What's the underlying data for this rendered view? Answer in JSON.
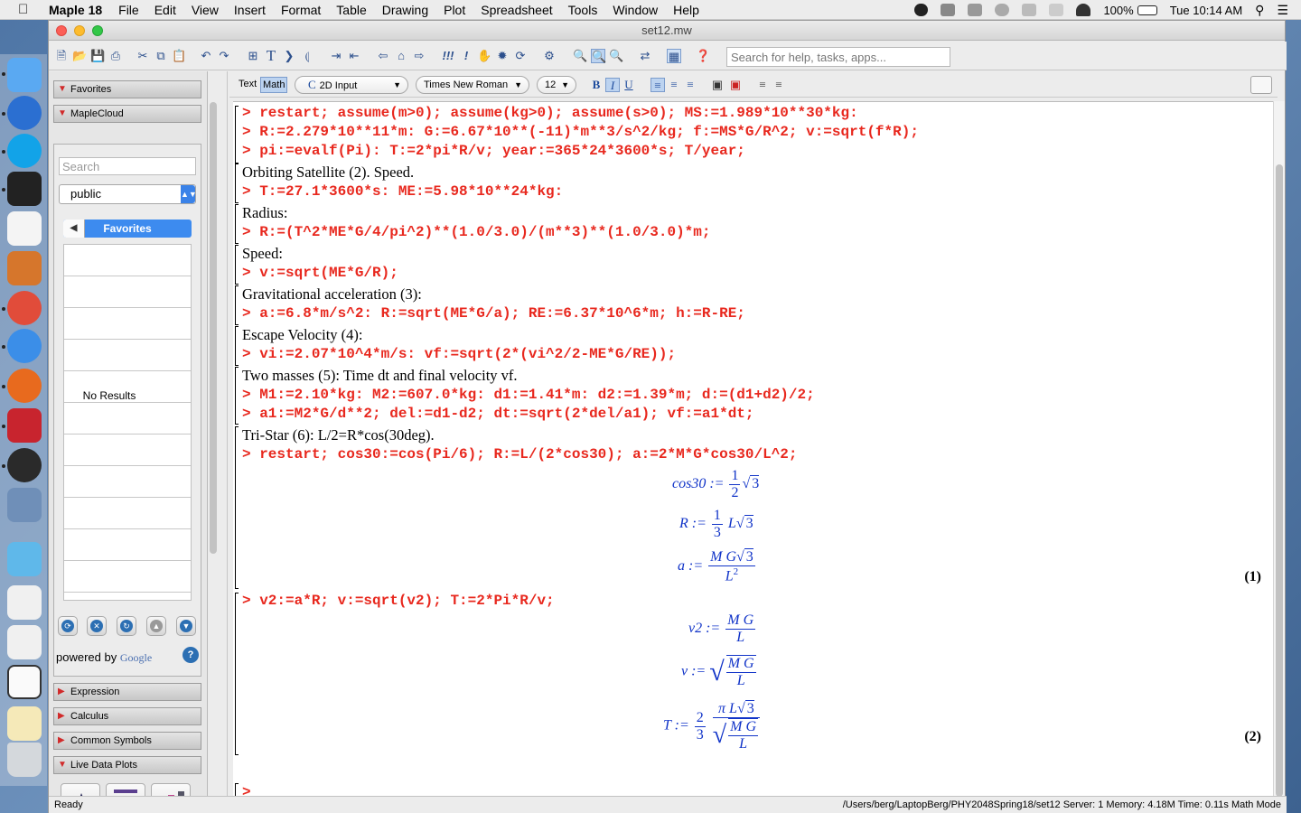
{
  "menubar": {
    "app_name": "Maple 18",
    "items": [
      "File",
      "Edit",
      "View",
      "Insert",
      "Format",
      "Table",
      "Drawing",
      "Plot",
      "Spreadsheet",
      "Tools",
      "Window",
      "Help"
    ],
    "battery": "100%",
    "clock": "Tue 10:14 AM"
  },
  "window": {
    "title": "set12.mw"
  },
  "toolbar": {
    "help_search_placeholder": "Search for help, tasks, apps..."
  },
  "palettes": {
    "favorites": "Favorites",
    "maplecloud": "MapleCloud",
    "cloud_search_placeholder": "Search",
    "cloud_group": "public",
    "cloud_tab": "Favorites",
    "no_results": "No Results",
    "powered_by": "powered by",
    "powered_brand": "Google",
    "expression": "Expression",
    "calculus": "Calculus",
    "common_symbols": "Common Symbols",
    "live_data_plots": "Live Data Plots"
  },
  "formatbar": {
    "mode_text": "Text",
    "mode_math": "Math",
    "input_style": "2D Input",
    "font": "Times New Roman",
    "size": "12"
  },
  "document": {
    "lines": [
      {
        "kind": "cmd",
        "text": "> restart; assume(m>0); assume(kg>0); assume(s>0); MS:=1.989*10**30*kg:"
      },
      {
        "kind": "cmd",
        "text": "> R:=2.279*10**11*m: G:=6.67*10**(-11)*m**3/s^2/kg; f:=MS*G/R^2; v:=sqrt(f*R);"
      },
      {
        "kind": "cmd",
        "text": "> pi:=evalf(Pi): T:=2*pi*R/v; year:=365*24*3600*s; T/year;"
      },
      {
        "kind": "txt",
        "text": "Orbiting Satellite (2). Speed."
      },
      {
        "kind": "cmd",
        "text": "> T:=27.1*3600*s: ME:=5.98*10**24*kg:"
      },
      {
        "kind": "txt",
        "text": "Radius:"
      },
      {
        "kind": "cmd",
        "text": "> R:=(T^2*ME*G/4/pi^2)**(1.0/3.0)/(m**3)**(1.0/3.0)*m;"
      },
      {
        "kind": "txt",
        "text": "Speed:"
      },
      {
        "kind": "cmd",
        "text": "> v:=sqrt(ME*G/R);"
      },
      {
        "kind": "txt",
        "text": "Gravitational acceleration (3):"
      },
      {
        "kind": "cmd",
        "text": "> a:=6.8*m/s^2: R:=sqrt(ME*G/a); RE:=6.37*10^6*m; h:=R-RE;"
      },
      {
        "kind": "txt",
        "text": "Escape Velocity (4):"
      },
      {
        "kind": "cmd",
        "text": "> vi:=2.07*10^4*m/s: vf:=sqrt(2*(vi^2/2-ME*G/RE));"
      },
      {
        "kind": "txt",
        "text": "Two masses (5): Time dt and final velocity vf."
      },
      {
        "kind": "cmd",
        "text": "> M1:=2.10*kg: M2:=607.0*kg: d1:=1.41*m: d2:=1.39*m; d:=(d1+d2)/2;"
      },
      {
        "kind": "cmd",
        "text": "> a1:=M2*G/d**2; del:=d1-d2; dt:=sqrt(2*del/a1); vf:=a1*dt;"
      },
      {
        "kind": "txt",
        "text": "Tri-Star (6): L/2=R*cos(30deg)."
      },
      {
        "kind": "cmd",
        "text": "> restart; cos30:=cos(Pi/6); R:=L/(2*cos30); a:=2*M*G*cos30/L^2;"
      }
    ],
    "out1": {
      "cos30_lhs": "cos30 :=",
      "cos30_num": "1",
      "cos30_den": "2",
      "cos30_rad": "3",
      "R_lhs": "R :=",
      "R_num": "1",
      "R_den": "3",
      "R_mid": "L",
      "R_rad": "3",
      "a_lhs": "a :=",
      "a_num": "M G",
      "a_rad": "3",
      "a_den": "L",
      "a_exp": "2",
      "label": "(1)"
    },
    "cmd2": "> v2:=a*R; v:=sqrt(v2); T:=2*Pi*R/v;",
    "out2": {
      "v2_lhs": "v2 :=",
      "v2_num": "M G",
      "v2_den": "L",
      "v_lhs": "v :=",
      "v_num": "M G",
      "v_den": "L",
      "T_lhs": "T :=",
      "T_c_num": "2",
      "T_c_den": "3",
      "T_num": "π L",
      "T_rad": "3",
      "T_inner_num": "M G",
      "T_inner_den": "L",
      "label": "(2)"
    },
    "prompt": ">"
  },
  "statusbar": {
    "left": "Ready",
    "right": "/Users/berg/LaptopBerg/PHY2048Spring18/set12   Server: 1   Memory: 4.18M   Time: 0.11s   Math Mode"
  }
}
